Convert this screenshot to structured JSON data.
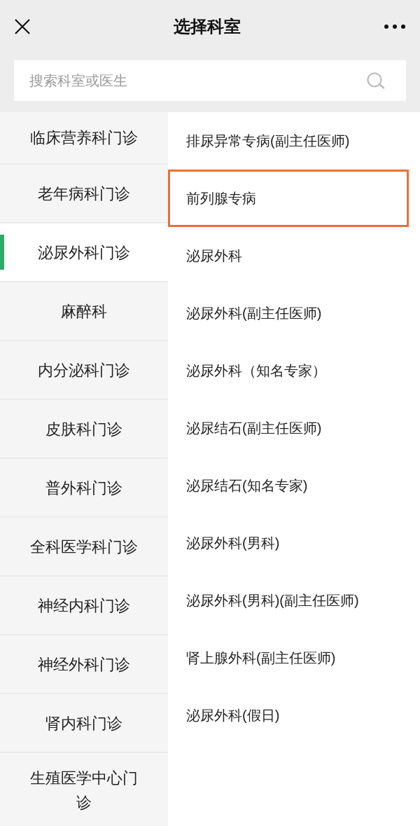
{
  "header": {
    "title": "选择科室"
  },
  "search": {
    "placeholder": "搜索科室或医生"
  },
  "departments": [
    {
      "name": "临床营养科门诊",
      "selected": false
    },
    {
      "name": "老年病科门诊",
      "selected": false
    },
    {
      "name": "泌尿外科门诊",
      "selected": true
    },
    {
      "name": "麻醉科",
      "selected": false
    },
    {
      "name": "内分泌科门诊",
      "selected": false
    },
    {
      "name": "皮肤科门诊",
      "selected": false
    },
    {
      "name": "普外科门诊",
      "selected": false
    },
    {
      "name": "全科医学科门诊",
      "selected": false
    },
    {
      "name": "神经内科门诊",
      "selected": false
    },
    {
      "name": "神经外科门诊",
      "selected": false
    },
    {
      "name": "肾内科门诊",
      "selected": false
    },
    {
      "name": "生殖医学中心门诊",
      "selected": false
    }
  ],
  "clinics": [
    {
      "name": "排尿异常专病(副主任医师)",
      "outlined": false
    },
    {
      "name": "前列腺专病",
      "outlined": true
    },
    {
      "name": "泌尿外科",
      "outlined": false
    },
    {
      "name": "泌尿外科(副主任医师)",
      "outlined": false
    },
    {
      "name": "泌尿外科（知名专家）",
      "outlined": false
    },
    {
      "name": "泌尿结石(副主任医师)",
      "outlined": false
    },
    {
      "name": "泌尿结石(知名专家)",
      "outlined": false
    },
    {
      "name": "泌尿外科(男科)",
      "outlined": false
    },
    {
      "name": "泌尿外科(男科)(副主任医师)",
      "outlined": false
    },
    {
      "name": "肾上腺外科(副主任医师)",
      "outlined": false
    },
    {
      "name": "泌尿外科(假日)",
      "outlined": false
    }
  ]
}
